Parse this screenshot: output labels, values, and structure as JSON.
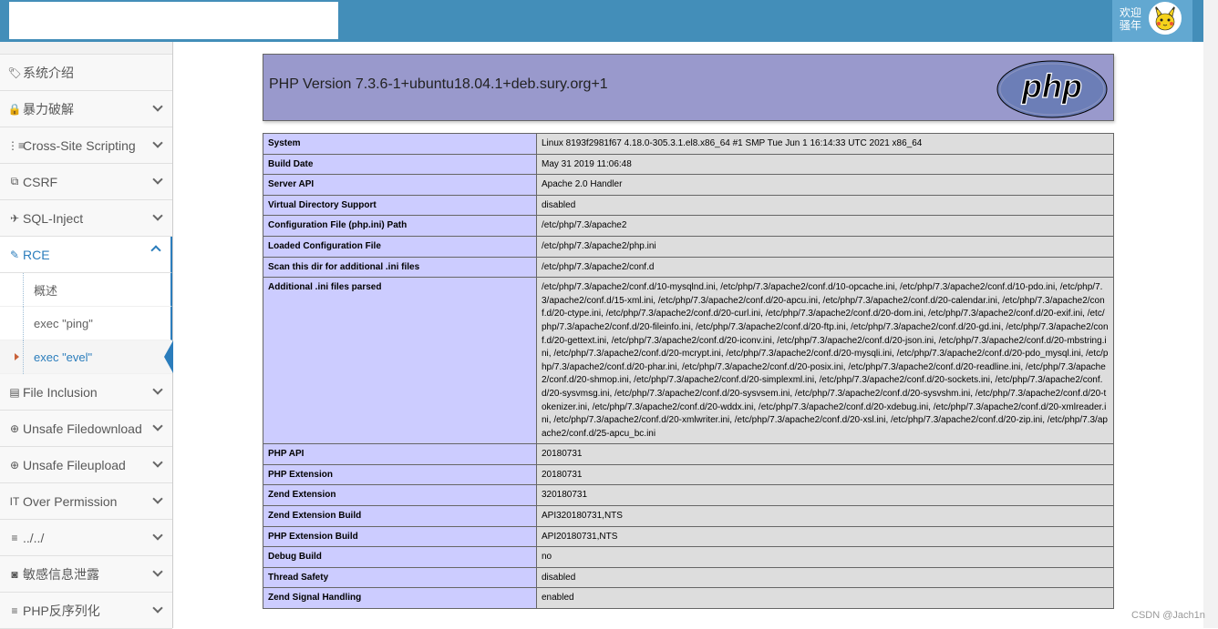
{
  "topbar": {
    "welcome": "欢迎\n骚年"
  },
  "sidebar": {
    "items": [
      {
        "icon": "tag-icon",
        "glyph": "🏷",
        "label": "系统介绍",
        "chevron": false
      },
      {
        "icon": "lock-icon",
        "glyph": "🔒",
        "label": "暴力破解",
        "chevron": true
      },
      {
        "icon": "list-icon",
        "glyph": "⋮≡",
        "label": "Cross-Site Scripting",
        "chevron": true
      },
      {
        "icon": "share-icon",
        "glyph": "⧉",
        "label": "CSRF",
        "chevron": true
      },
      {
        "icon": "fighter-jet-icon",
        "glyph": "✈",
        "label": "SQL-Inject",
        "chevron": true
      },
      {
        "icon": "pencil-icon",
        "glyph": "✎",
        "label": "RCE",
        "chevron": true,
        "open": true,
        "sub": [
          {
            "label": "概述"
          },
          {
            "label": "exec \"ping\""
          },
          {
            "label": "exec \"evel\"",
            "active": true
          }
        ]
      },
      {
        "icon": "file-icon",
        "glyph": "▤",
        "label": "File Inclusion",
        "chevron": true
      },
      {
        "icon": "download-icon",
        "glyph": "⊕",
        "label": "Unsafe Filedownload",
        "chevron": true
      },
      {
        "icon": "upload-icon",
        "glyph": "⊕",
        "label": "Unsafe Fileupload",
        "chevron": true
      },
      {
        "icon": "text-height-icon",
        "glyph": "IT",
        "label": "Over Permission",
        "chevron": true
      },
      {
        "icon": "align-left-icon",
        "glyph": "≡",
        "label": "../../",
        "chevron": true
      },
      {
        "icon": "camera-icon",
        "glyph": "◙",
        "label": "敏感信息泄露",
        "chevron": true
      },
      {
        "icon": "align-left-icon",
        "glyph": "≡",
        "label": "PHP反序列化",
        "chevron": true
      }
    ]
  },
  "phpinfo": {
    "title": "PHP Version 7.3.6-1+ubuntu18.04.1+deb.sury.org+1",
    "logo_text": "php",
    "rows": [
      {
        "k": "System",
        "v": "Linux 8193f2981f67 4.18.0-305.3.1.el8.x86_64 #1 SMP Tue Jun 1 16:14:33 UTC 2021 x86_64"
      },
      {
        "k": "Build Date",
        "v": "May 31 2019 11:06:48"
      },
      {
        "k": "Server API",
        "v": "Apache 2.0 Handler"
      },
      {
        "k": "Virtual Directory Support",
        "v": "disabled"
      },
      {
        "k": "Configuration File (php.ini) Path",
        "v": "/etc/php/7.3/apache2"
      },
      {
        "k": "Loaded Configuration File",
        "v": "/etc/php/7.3/apache2/php.ini"
      },
      {
        "k": "Scan this dir for additional .ini files",
        "v": "/etc/php/7.3/apache2/conf.d"
      },
      {
        "k": "Additional .ini files parsed",
        "v": "/etc/php/7.3/apache2/conf.d/10-mysqlnd.ini, /etc/php/7.3/apache2/conf.d/10-opcache.ini, /etc/php/7.3/apache2/conf.d/10-pdo.ini, /etc/php/7.3/apache2/conf.d/15-xml.ini, /etc/php/7.3/apache2/conf.d/20-apcu.ini, /etc/php/7.3/apache2/conf.d/20-calendar.ini, /etc/php/7.3/apache2/conf.d/20-ctype.ini, /etc/php/7.3/apache2/conf.d/20-curl.ini, /etc/php/7.3/apache2/conf.d/20-dom.ini, /etc/php/7.3/apache2/conf.d/20-exif.ini, /etc/php/7.3/apache2/conf.d/20-fileinfo.ini, /etc/php/7.3/apache2/conf.d/20-ftp.ini, /etc/php/7.3/apache2/conf.d/20-gd.ini, /etc/php/7.3/apache2/conf.d/20-gettext.ini, /etc/php/7.3/apache2/conf.d/20-iconv.ini, /etc/php/7.3/apache2/conf.d/20-json.ini, /etc/php/7.3/apache2/conf.d/20-mbstring.ini, /etc/php/7.3/apache2/conf.d/20-mcrypt.ini, /etc/php/7.3/apache2/conf.d/20-mysqli.ini, /etc/php/7.3/apache2/conf.d/20-pdo_mysql.ini, /etc/php/7.3/apache2/conf.d/20-phar.ini, /etc/php/7.3/apache2/conf.d/20-posix.ini, /etc/php/7.3/apache2/conf.d/20-readline.ini, /etc/php/7.3/apache2/conf.d/20-shmop.ini, /etc/php/7.3/apache2/conf.d/20-simplexml.ini, /etc/php/7.3/apache2/conf.d/20-sockets.ini, /etc/php/7.3/apache2/conf.d/20-sysvmsg.ini, /etc/php/7.3/apache2/conf.d/20-sysvsem.ini, /etc/php/7.3/apache2/conf.d/20-sysvshm.ini, /etc/php/7.3/apache2/conf.d/20-tokenizer.ini, /etc/php/7.3/apache2/conf.d/20-wddx.ini, /etc/php/7.3/apache2/conf.d/20-xdebug.ini, /etc/php/7.3/apache2/conf.d/20-xmlreader.ini, /etc/php/7.3/apache2/conf.d/20-xmlwriter.ini, /etc/php/7.3/apache2/conf.d/20-xsl.ini, /etc/php/7.3/apache2/conf.d/20-zip.ini, /etc/php/7.3/apache2/conf.d/25-apcu_bc.ini"
      },
      {
        "k": "PHP API",
        "v": "20180731"
      },
      {
        "k": "PHP Extension",
        "v": "20180731"
      },
      {
        "k": "Zend Extension",
        "v": "320180731"
      },
      {
        "k": "Zend Extension Build",
        "v": "API320180731,NTS"
      },
      {
        "k": "PHP Extension Build",
        "v": "API20180731,NTS"
      },
      {
        "k": "Debug Build",
        "v": "no"
      },
      {
        "k": "Thread Safety",
        "v": "disabled"
      },
      {
        "k": "Zend Signal Handling",
        "v": "enabled"
      }
    ]
  },
  "watermark": "CSDN @Jach1n"
}
